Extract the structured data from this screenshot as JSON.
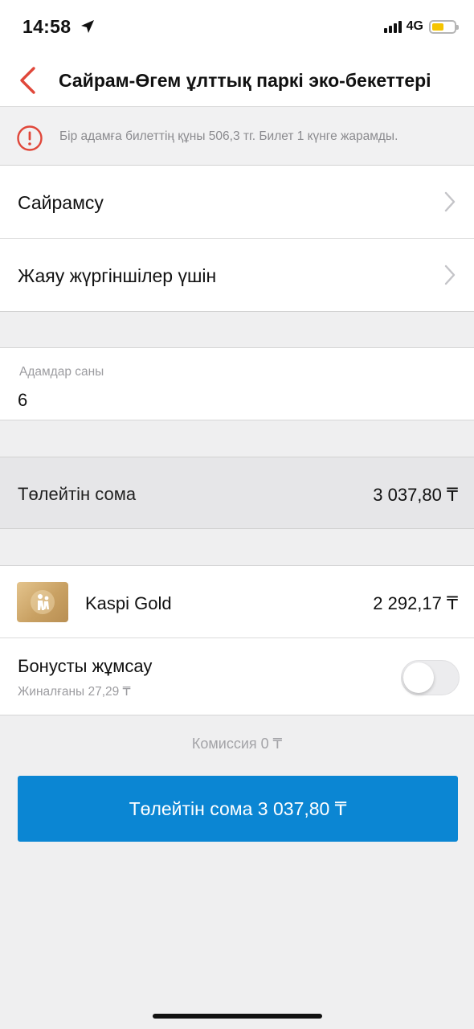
{
  "status_bar": {
    "time": "14:58",
    "network": "4G",
    "location_icon": "location-arrow-icon",
    "battery_color": "#f5c400"
  },
  "header": {
    "back_icon": "chevron-left-icon",
    "title": "Сайрам-Өгем ұлттық паркі эко-бекеттері",
    "accent_color": "#e0473a"
  },
  "info_banner": {
    "icon": "info-circle-icon",
    "text": "Бір адамға билеттің құны 506,3 тг. Билет  1 күнге жарамды."
  },
  "selectors": [
    {
      "label": "Сайрамсу",
      "icon": "chevron-right-icon"
    },
    {
      "label": "Жаяу жүргіншілер үшін",
      "icon": "chevron-right-icon"
    }
  ],
  "people_count": {
    "label": "Адамдар саны",
    "value": "6"
  },
  "total": {
    "label": "Төлейтін сома",
    "value": "3 037,80 ₸"
  },
  "card": {
    "name": "Kaspi Gold",
    "balance": "2 292,17 ₸",
    "icon": "kaspi-gold-card-icon"
  },
  "bonus": {
    "label": "Бонусты жұмсау",
    "sub": "Жиналғаны 27,29 ₸",
    "enabled": false
  },
  "commission": "Комиссия 0 ₸",
  "pay_button": {
    "label": "Төлейтін сома 3 037,80 ₸",
    "color": "#0b86d3"
  }
}
